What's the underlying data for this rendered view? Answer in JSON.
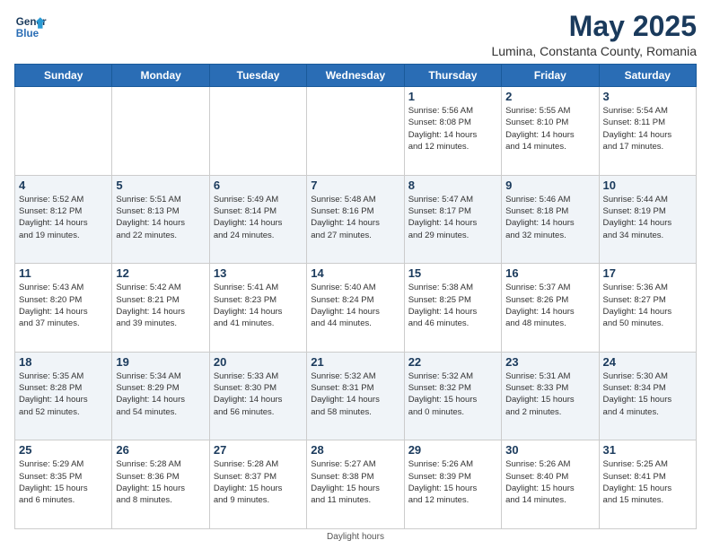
{
  "header": {
    "logo_line1": "General",
    "logo_line2": "Blue",
    "main_title": "May 2025",
    "subtitle": "Lumina, Constanta County, Romania"
  },
  "days_of_week": [
    "Sunday",
    "Monday",
    "Tuesday",
    "Wednesday",
    "Thursday",
    "Friday",
    "Saturday"
  ],
  "footer": {
    "note": "Daylight hours"
  },
  "weeks": [
    [
      {
        "num": "",
        "info": ""
      },
      {
        "num": "",
        "info": ""
      },
      {
        "num": "",
        "info": ""
      },
      {
        "num": "",
        "info": ""
      },
      {
        "num": "1",
        "info": "Sunrise: 5:56 AM\nSunset: 8:08 PM\nDaylight: 14 hours\nand 12 minutes."
      },
      {
        "num": "2",
        "info": "Sunrise: 5:55 AM\nSunset: 8:10 PM\nDaylight: 14 hours\nand 14 minutes."
      },
      {
        "num": "3",
        "info": "Sunrise: 5:54 AM\nSunset: 8:11 PM\nDaylight: 14 hours\nand 17 minutes."
      }
    ],
    [
      {
        "num": "4",
        "info": "Sunrise: 5:52 AM\nSunset: 8:12 PM\nDaylight: 14 hours\nand 19 minutes."
      },
      {
        "num": "5",
        "info": "Sunrise: 5:51 AM\nSunset: 8:13 PM\nDaylight: 14 hours\nand 22 minutes."
      },
      {
        "num": "6",
        "info": "Sunrise: 5:49 AM\nSunset: 8:14 PM\nDaylight: 14 hours\nand 24 minutes."
      },
      {
        "num": "7",
        "info": "Sunrise: 5:48 AM\nSunset: 8:16 PM\nDaylight: 14 hours\nand 27 minutes."
      },
      {
        "num": "8",
        "info": "Sunrise: 5:47 AM\nSunset: 8:17 PM\nDaylight: 14 hours\nand 29 minutes."
      },
      {
        "num": "9",
        "info": "Sunrise: 5:46 AM\nSunset: 8:18 PM\nDaylight: 14 hours\nand 32 minutes."
      },
      {
        "num": "10",
        "info": "Sunrise: 5:44 AM\nSunset: 8:19 PM\nDaylight: 14 hours\nand 34 minutes."
      }
    ],
    [
      {
        "num": "11",
        "info": "Sunrise: 5:43 AM\nSunset: 8:20 PM\nDaylight: 14 hours\nand 37 minutes."
      },
      {
        "num": "12",
        "info": "Sunrise: 5:42 AM\nSunset: 8:21 PM\nDaylight: 14 hours\nand 39 minutes."
      },
      {
        "num": "13",
        "info": "Sunrise: 5:41 AM\nSunset: 8:23 PM\nDaylight: 14 hours\nand 41 minutes."
      },
      {
        "num": "14",
        "info": "Sunrise: 5:40 AM\nSunset: 8:24 PM\nDaylight: 14 hours\nand 44 minutes."
      },
      {
        "num": "15",
        "info": "Sunrise: 5:38 AM\nSunset: 8:25 PM\nDaylight: 14 hours\nand 46 minutes."
      },
      {
        "num": "16",
        "info": "Sunrise: 5:37 AM\nSunset: 8:26 PM\nDaylight: 14 hours\nand 48 minutes."
      },
      {
        "num": "17",
        "info": "Sunrise: 5:36 AM\nSunset: 8:27 PM\nDaylight: 14 hours\nand 50 minutes."
      }
    ],
    [
      {
        "num": "18",
        "info": "Sunrise: 5:35 AM\nSunset: 8:28 PM\nDaylight: 14 hours\nand 52 minutes."
      },
      {
        "num": "19",
        "info": "Sunrise: 5:34 AM\nSunset: 8:29 PM\nDaylight: 14 hours\nand 54 minutes."
      },
      {
        "num": "20",
        "info": "Sunrise: 5:33 AM\nSunset: 8:30 PM\nDaylight: 14 hours\nand 56 minutes."
      },
      {
        "num": "21",
        "info": "Sunrise: 5:32 AM\nSunset: 8:31 PM\nDaylight: 14 hours\nand 58 minutes."
      },
      {
        "num": "22",
        "info": "Sunrise: 5:32 AM\nSunset: 8:32 PM\nDaylight: 15 hours\nand 0 minutes."
      },
      {
        "num": "23",
        "info": "Sunrise: 5:31 AM\nSunset: 8:33 PM\nDaylight: 15 hours\nand 2 minutes."
      },
      {
        "num": "24",
        "info": "Sunrise: 5:30 AM\nSunset: 8:34 PM\nDaylight: 15 hours\nand 4 minutes."
      }
    ],
    [
      {
        "num": "25",
        "info": "Sunrise: 5:29 AM\nSunset: 8:35 PM\nDaylight: 15 hours\nand 6 minutes."
      },
      {
        "num": "26",
        "info": "Sunrise: 5:28 AM\nSunset: 8:36 PM\nDaylight: 15 hours\nand 8 minutes."
      },
      {
        "num": "27",
        "info": "Sunrise: 5:28 AM\nSunset: 8:37 PM\nDaylight: 15 hours\nand 9 minutes."
      },
      {
        "num": "28",
        "info": "Sunrise: 5:27 AM\nSunset: 8:38 PM\nDaylight: 15 hours\nand 11 minutes."
      },
      {
        "num": "29",
        "info": "Sunrise: 5:26 AM\nSunset: 8:39 PM\nDaylight: 15 hours\nand 12 minutes."
      },
      {
        "num": "30",
        "info": "Sunrise: 5:26 AM\nSunset: 8:40 PM\nDaylight: 15 hours\nand 14 minutes."
      },
      {
        "num": "31",
        "info": "Sunrise: 5:25 AM\nSunset: 8:41 PM\nDaylight: 15 hours\nand 15 minutes."
      }
    ]
  ]
}
